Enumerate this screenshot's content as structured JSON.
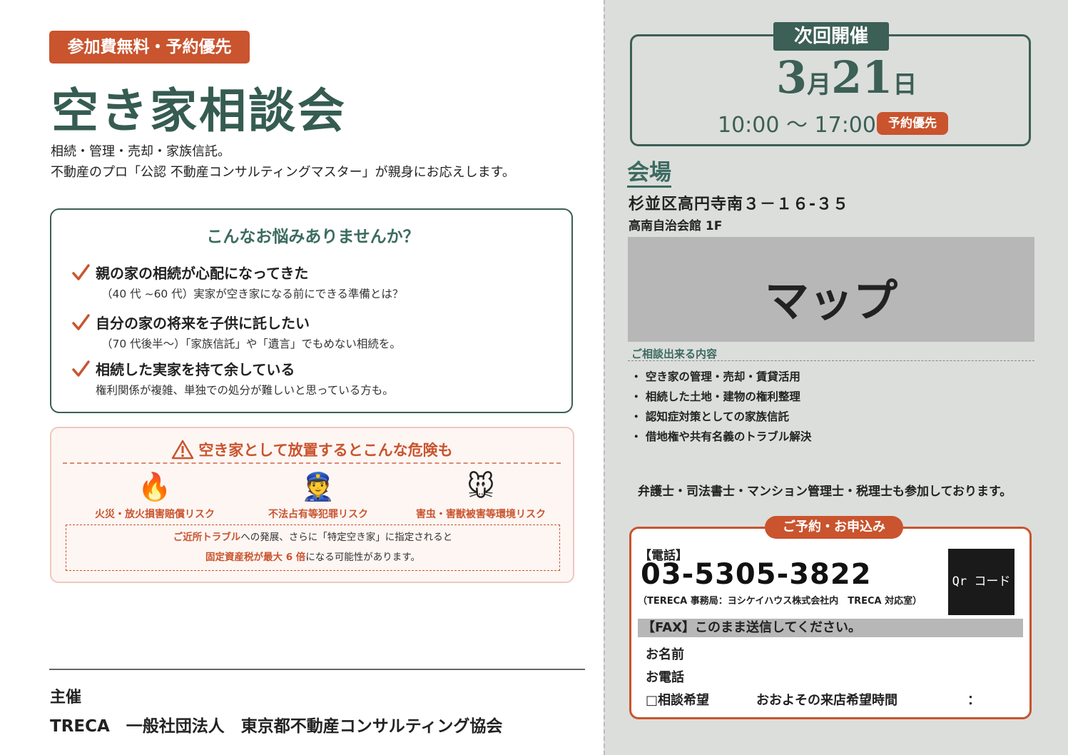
{
  "left": {
    "badge": "参加費無料・予約優先",
    "title": "空き家相談会",
    "intro_line1": "相続・管理・売却・家族信託。",
    "intro_line2": "不動産のプロ「公認 不動産コンサルティングマスター」が親身にお応えします。",
    "worries": {
      "title": "こんなお悩みありませんか？",
      "items": [
        {
          "head": "親の家の相続が心配になってきた",
          "sub": "（40 代 ~60 代）実家が空き家になる前にできる準備とは？"
        },
        {
          "head": "自分の家の将来を子供に託したい",
          "sub": "（70 代後半〜）「家族信託」や「遺言」でもめない相続を。"
        },
        {
          "head": "相続した実家を持て余している",
          "sub": "権利関係が複雑、単独での処分が難しいと思っている方も。"
        }
      ]
    },
    "danger": {
      "title": "空き家として放置するとこんな危険も",
      "risks": [
        {
          "emoji": "🔥",
          "label": "火災・放火損害賠償リスク"
        },
        {
          "emoji": "👮",
          "label": "不法占有等犯罪リスク"
        },
        {
          "emoji": "🐭",
          "label": "害虫・害獣被害等環境リスク"
        }
      ],
      "notice_b1": "ご近所トラブル",
      "notice_t1": "への発展、さらに「特定空き家」に指定されると",
      "notice_b2": "固定資産税が最大 6 倍",
      "notice_t2": "になる可能性があります。"
    },
    "host_label": "主催",
    "host_name": "TRECA　一般社団法人　東京都不動産コンサルティング協会"
  },
  "right": {
    "next_label": "次回開催",
    "month": "3",
    "month_unit": "月",
    "day": "21",
    "day_unit": "日",
    "time": "10:00 〜 17:00",
    "reserve_badge": "予約優先",
    "venue_label": "会場",
    "address": "杉並区高円寺南３－１６-３５",
    "hall": "高南自治会館 1F",
    "map_label": "マップ",
    "consult_title": "ご相談出来る内容",
    "consult_items": [
      "空き家の管理・売却・賃貸活用",
      "相続した土地・建物の権利整理",
      "認知症対策としての家族信託",
      "借地権や共有名義のトラブル解決"
    ],
    "experts": "弁護士・司法書士・マンション管理士・税理士も参加しております。",
    "reservation_label": "ご予約・お申込み",
    "tel_label": "【電話】",
    "tel": "03-5305-3822",
    "tel_office": "（TERECA 事務局：ヨシケイハウス株式会社内　TRECA 対応室）",
    "qr_label": "Qr コード",
    "fax_label": "【FAX】このまま送信してください。",
    "field_name": "お名前",
    "field_phone": "お電話",
    "field_consult": "□相談希望",
    "field_time": "おおよその来店希望時間",
    "field_colon": "：",
    "accent_color": "#c9542e",
    "brand_color": "#3c5f56"
  }
}
